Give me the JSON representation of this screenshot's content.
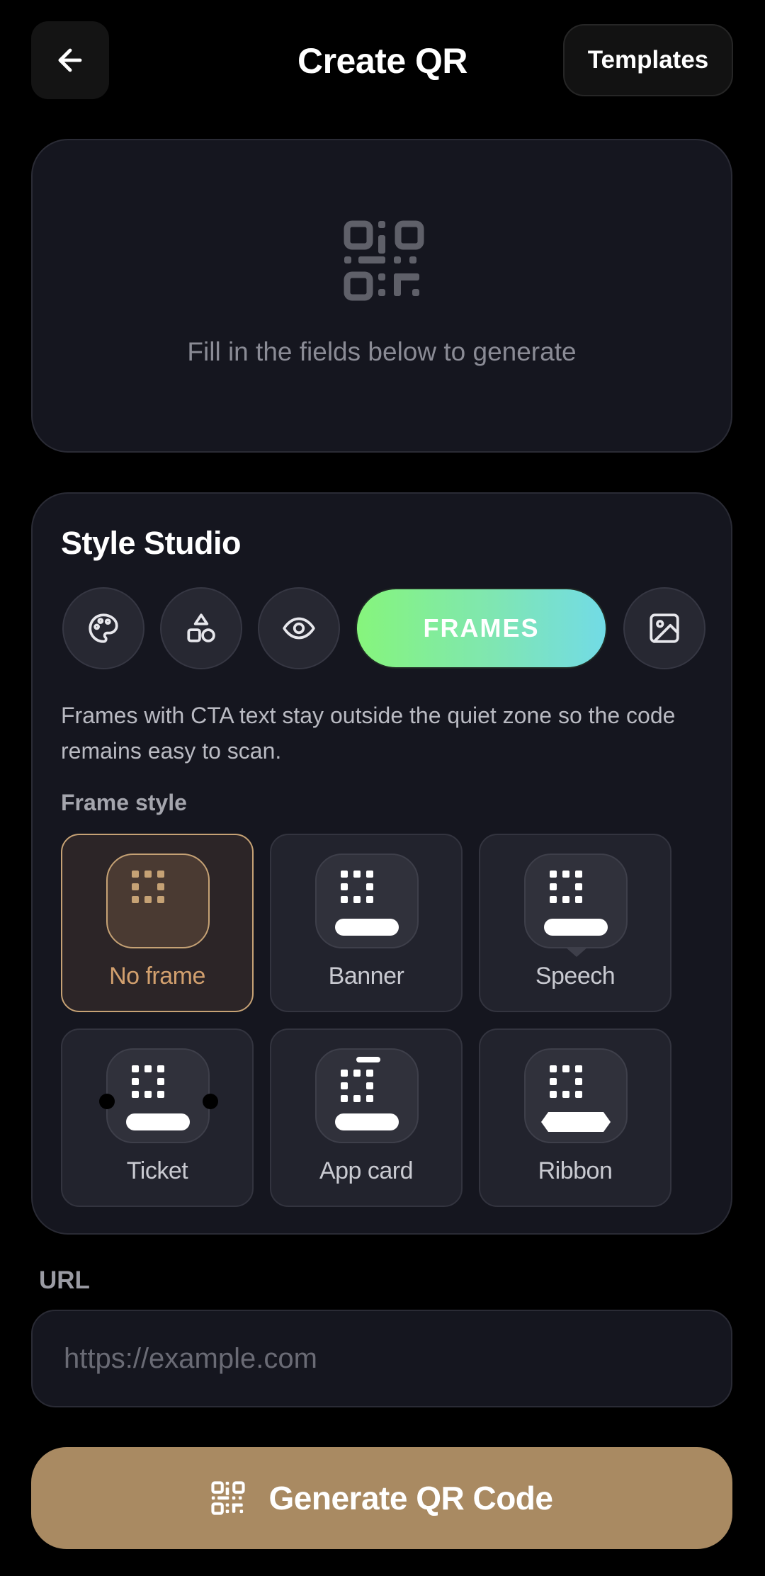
{
  "header": {
    "back_icon": "arrow-left-icon",
    "title": "Create QR",
    "templates_label": "Templates"
  },
  "preview": {
    "icon": "qr-code-icon",
    "hint": "Fill in the fields below to generate"
  },
  "studio": {
    "title": "Style Studio",
    "tools": [
      {
        "icon": "palette-icon",
        "active": false
      },
      {
        "icon": "shapes-icon",
        "active": false
      },
      {
        "icon": "eye-icon",
        "active": false
      },
      {
        "label": "FRAMES",
        "active": true
      },
      {
        "icon": "image-icon",
        "active": false
      }
    ],
    "description": "Frames with CTA text stay outside the quiet zone so the code remains easy to scan.",
    "frame_style_label": "Frame style",
    "frames": [
      {
        "label": "No frame",
        "selected": true
      },
      {
        "label": "Banner",
        "selected": false
      },
      {
        "label": "Speech",
        "selected": false
      },
      {
        "label": "Ticket",
        "selected": false
      },
      {
        "label": "App card",
        "selected": false
      },
      {
        "label": "Ribbon",
        "selected": false
      }
    ]
  },
  "url": {
    "label": "URL",
    "placeholder": "https://example.com",
    "value": ""
  },
  "generate": {
    "icon": "qr-code-icon",
    "label": "Generate QR Code"
  },
  "colors": {
    "background": "#000000",
    "card": "#15161f",
    "accent": "#a98a62",
    "selected_border": "#c6a275",
    "frames_gradient_start": "#86f57c",
    "frames_gradient_end": "#72dbe6"
  }
}
